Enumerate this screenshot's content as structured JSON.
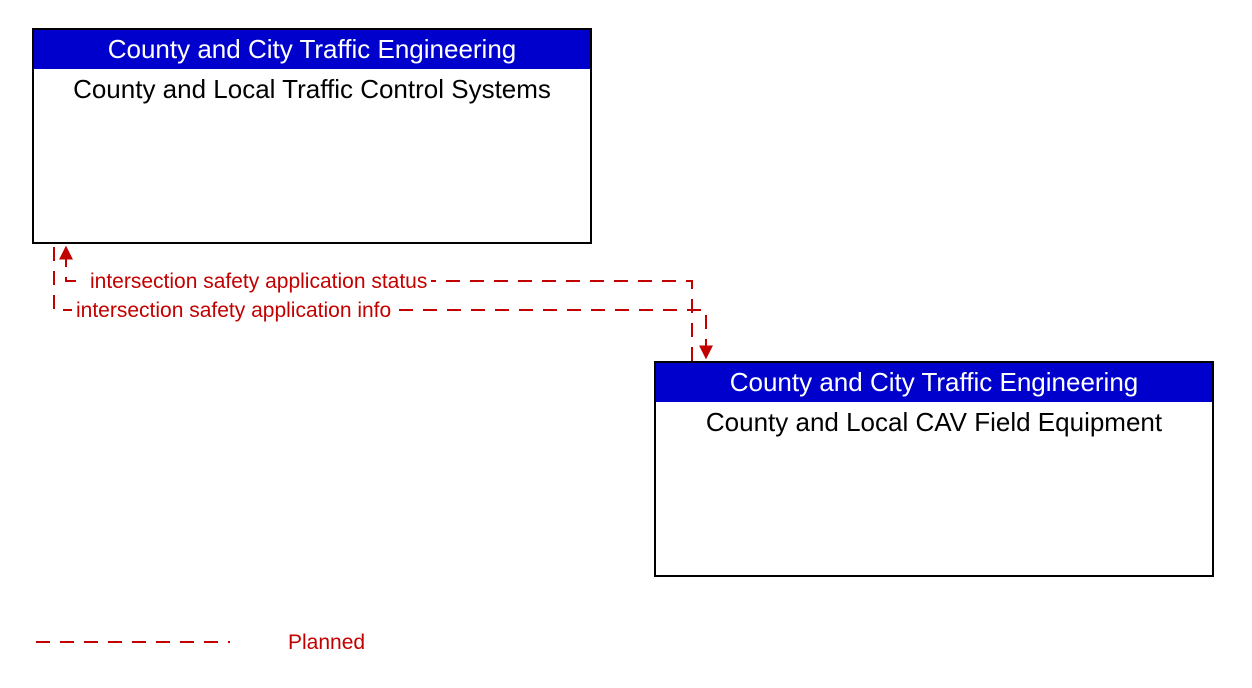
{
  "nodes": {
    "top": {
      "header": "County and City Traffic Engineering",
      "body": "County and Local Traffic Control Systems"
    },
    "bottom": {
      "header": "County and City Traffic Engineering",
      "body": "County and Local CAV Field Equipment"
    }
  },
  "flows": {
    "status": "intersection safety application status",
    "info": "intersection safety application info"
  },
  "legend": {
    "planned": "Planned"
  },
  "colors": {
    "header_bg": "#0000cc",
    "planned": "#c30000"
  }
}
